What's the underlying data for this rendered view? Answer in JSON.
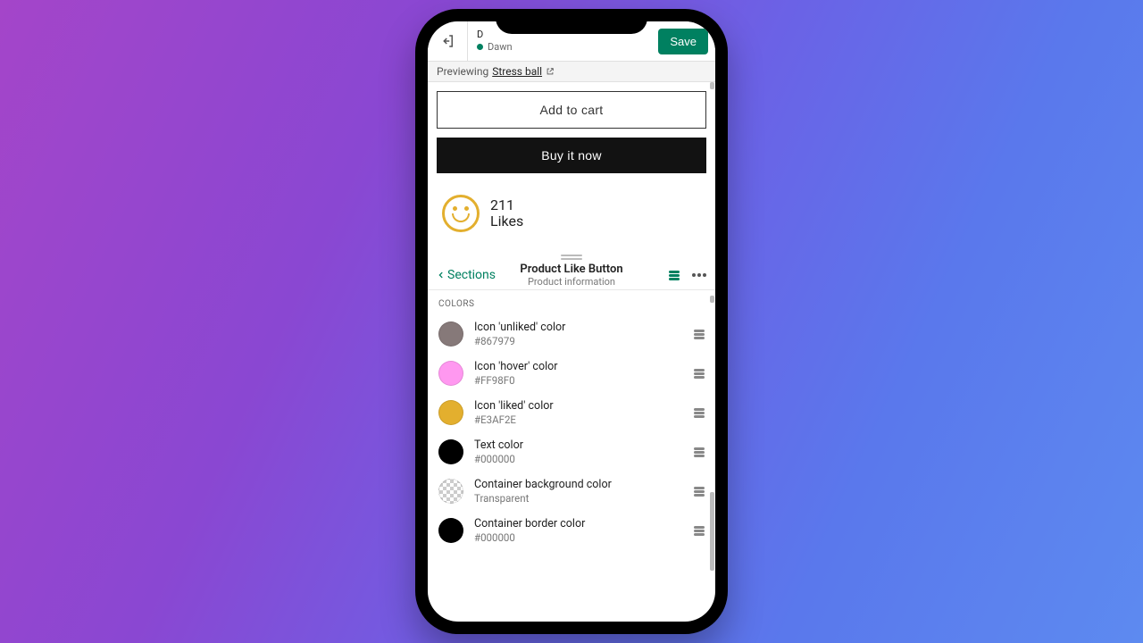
{
  "topbar": {
    "theme_title_prefix": "D",
    "theme_name": "Dawn",
    "save_label": "Save"
  },
  "preview": {
    "prefix": "Previewing",
    "product_name": "Stress ball",
    "add_to_cart": "Add to cart",
    "buy_now": "Buy it now",
    "likes_count": "211",
    "likes_label": "Likes"
  },
  "section": {
    "back_label": "Sections",
    "title": "Product Like Button",
    "subtitle": "Product information"
  },
  "settings": {
    "group_title": "COLORS",
    "rows": [
      {
        "label": "Icon 'unliked' color",
        "value": "#867979",
        "swatch": "#867979"
      },
      {
        "label": "Icon 'hover' color",
        "value": "#FF98F0",
        "swatch": "#FF98F0"
      },
      {
        "label": "Icon 'liked' color",
        "value": "#E3AF2E",
        "swatch": "#E3AF2E"
      },
      {
        "label": "Text color",
        "value": "#000000",
        "swatch": "#000000"
      },
      {
        "label": "Container background color",
        "value": "Transparent",
        "swatch": "transparent"
      },
      {
        "label": "Container border color",
        "value": "#000000",
        "swatch": "#000000"
      }
    ]
  }
}
